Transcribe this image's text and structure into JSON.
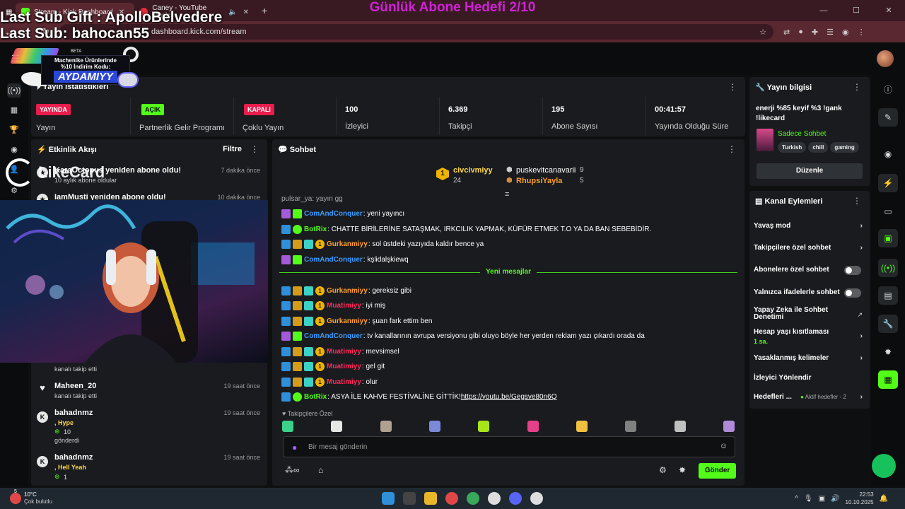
{
  "overlay": {
    "goal": "Günlük Abone Hedefi 2/10",
    "last_gift": "Last Sub Gift : ApolloBelvedere",
    "last_sub": "Last Sub: bahocan55"
  },
  "browser": {
    "tabs": [
      {
        "title": "Stream - Kick Dashboard"
      },
      {
        "title": "Caney - YouTube Music"
      }
    ],
    "url": "dashboard.kick.com/stream"
  },
  "promo": {
    "line1": "Machenike Ürünlerinde",
    "line2": "%10 İndirim Kodu:",
    "code": "AYDAMIYY",
    "beta": "BETA"
  },
  "likecard": {
    "brand": "LikeCard"
  },
  "stats": {
    "title": "Yayın İstatistikleri",
    "items": [
      {
        "badge": "YAYINDA",
        "label": "Yayın"
      },
      {
        "badge": "AÇIK",
        "label": "Partnerlik Gelir Programı"
      },
      {
        "badge": "KAPALI",
        "label": "Çoklu Yayın"
      },
      {
        "value": "100",
        "label": "İzleyici"
      },
      {
        "value": "6.369",
        "label": "Takipçi"
      },
      {
        "value": "195",
        "label": "Abone Sayısı"
      },
      {
        "value": "00:41:57",
        "label": "Yayında Olduğu Süre"
      }
    ]
  },
  "activity": {
    "title": "Etkinlik Akışı",
    "filter": "Filtre",
    "items": [
      {
        "name": "KaraOctopus yeniden abone oldu!",
        "sub": "10 aylık abone oldular",
        "time": "7 dakika önce"
      },
      {
        "name": "IamMusti yeniden abone oldu!",
        "time": "10 dakika önce"
      },
      {
        "name": "kanalı takip etti"
      },
      {
        "name": "Maheen_20",
        "sub": "kanalı takip etti",
        "time": "19 saat önce"
      },
      {
        "name": "bahadnmz",
        "hype": ", Hype",
        "amount": "10",
        "gift": "gönderdi",
        "time": "19 saat önce"
      },
      {
        "name": "bahadnmz",
        "hype": ", Hell Yeah",
        "amount": "1",
        "time": "19 saat önce"
      }
    ]
  },
  "chat": {
    "title": "Sohbet",
    "pinned": {
      "rank": "1",
      "user": "civcivmiyy",
      "count": "24",
      "u2": "puskevitcanavarii",
      "c2": "9",
      "u3": "RhupsiYayla",
      "c3": "5"
    },
    "messages": [
      {
        "user": "ComAndConquer",
        "color": "#3b9dff",
        "text": ": yeni yayıncı"
      },
      {
        "user": "BotRix",
        "color": "#53fc18",
        "text": ": CHATTE BİRİLERİNE SATAŞMAK, IRKCILIK YAPMAK, KÜFÜR ETMEK T.O YA DA BAN SEBEBİDİR."
      },
      {
        "user": "Gurkanmiyy",
        "color": "#ff9f2a",
        "text": ": sol üstdeki yazıyıda kaldır bence ya"
      },
      {
        "user": "ComAndConquer",
        "color": "#3b9dff",
        "text": ": kşlidalşkiewq"
      },
      {
        "user": "Gurkanmiyy",
        "color": "#ff9f2a",
        "text": ": gereksiz gibi"
      },
      {
        "user": "Muatimiyy",
        "color": "#ff2a5c",
        "text": ": iyi miş"
      },
      {
        "user": "Gurkanmiyy",
        "color": "#ff9f2a",
        "text": ": şuan fark ettim ben"
      },
      {
        "user": "ComAndConquer",
        "color": "#3b9dff",
        "text": ": tv kanallarının avrupa versiyonu gibi oluyo böyle her yerden reklam yazı çıkardı orada da"
      },
      {
        "user": "Muatimiyy",
        "color": "#ff2a5c",
        "text": ": mevsimsel"
      },
      {
        "user": "Muatimiyy",
        "color": "#ff2a5c",
        "text": ": gel git"
      },
      {
        "user": "Muatimiyy",
        "color": "#ff2a5c",
        "text": ": olur"
      },
      {
        "user": "BotRix",
        "color": "#53fc18",
        "text": ": ASYA İLE KAHVE FESTİVALİNE GİTTİK! ",
        "link": "https://youtu.be/Gegsve80n6Q"
      }
    ],
    "partial": "pulsar_ya: yayın gg",
    "new_messages": "Yeni mesajlar",
    "followers_only": "Takipçilere Özel",
    "placeholder": "Bir mesaj gönderin",
    "send": "Gönder"
  },
  "info": {
    "title": "Yayın bilgisi",
    "stream_title": "enerji %85 keyif %3 !gank !likecard",
    "category": "Sadece Sohbet",
    "tags": [
      "Turkish",
      "chill",
      "gaming"
    ],
    "edit": "Düzenle"
  },
  "actions": {
    "title": "Kanal Eylemleri",
    "items": [
      "Yavaş mod",
      "Takipçilere özel sohbet",
      "Abonelere özel sohbet",
      "Yalnızca ifadelerle sohbet",
      "Yapay Zeka ile Sohbet Denetimi",
      "Hesap yaşı kısıtlaması",
      "Yasaklanmış kelimeler",
      "İzleyici Yönlendir",
      "Hedefleri ..."
    ],
    "age": "1 sa.",
    "goals": "Aktif hedefler - 2"
  },
  "taskbar": {
    "temp": "10°C",
    "weather": "Çok bulutlu",
    "time": "22:53",
    "date": "10.10.2025",
    "notif": "5"
  },
  "colors": {
    "accent": "#53fc18",
    "bg": "#0e0f10",
    "panel": "#191b1f",
    "overlay_title": "#d021d8"
  }
}
